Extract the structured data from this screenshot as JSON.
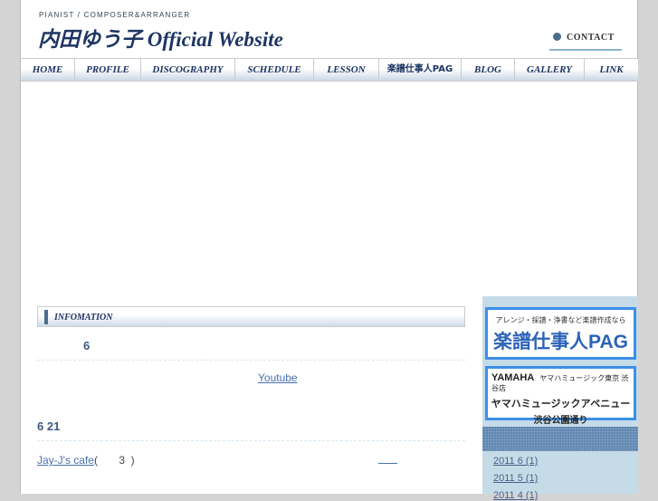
{
  "header": {
    "tagline": "PIANIST / COMPOSER&ARRANGER",
    "logo": "内田ゆう子 Official Website",
    "contact": "CONTACT"
  },
  "nav": [
    "HOME",
    "PROFILE",
    "DISCOGRAPHY",
    "SCHEDULE",
    "LESSON",
    "楽譜仕事人PAG",
    "BLOG",
    "GALLERY",
    "LINK"
  ],
  "info": {
    "heading": "INFOMATION",
    "entries": [
      {
        "date": "6",
        "link": "Youtube"
      },
      {
        "date": "6  21",
        "link": "Jay-J's cafe",
        "text": "(       3  )"
      }
    ]
  },
  "sidebar": {
    "banner1": {
      "sub": "アレンジ・採譜・浄書など楽譜作成なら",
      "title": "楽譜仕事人PAG"
    },
    "banner2": {
      "brand": "YAMAHA",
      "store": "ヤマハミュージック東京 渋谷店",
      "line1": "ヤマハミュージックアベニュー",
      "line2": "渋谷公園通り"
    },
    "archives": [
      "2011 6  (1)",
      "2011 5  (1)",
      "2011 4  (1)"
    ]
  }
}
